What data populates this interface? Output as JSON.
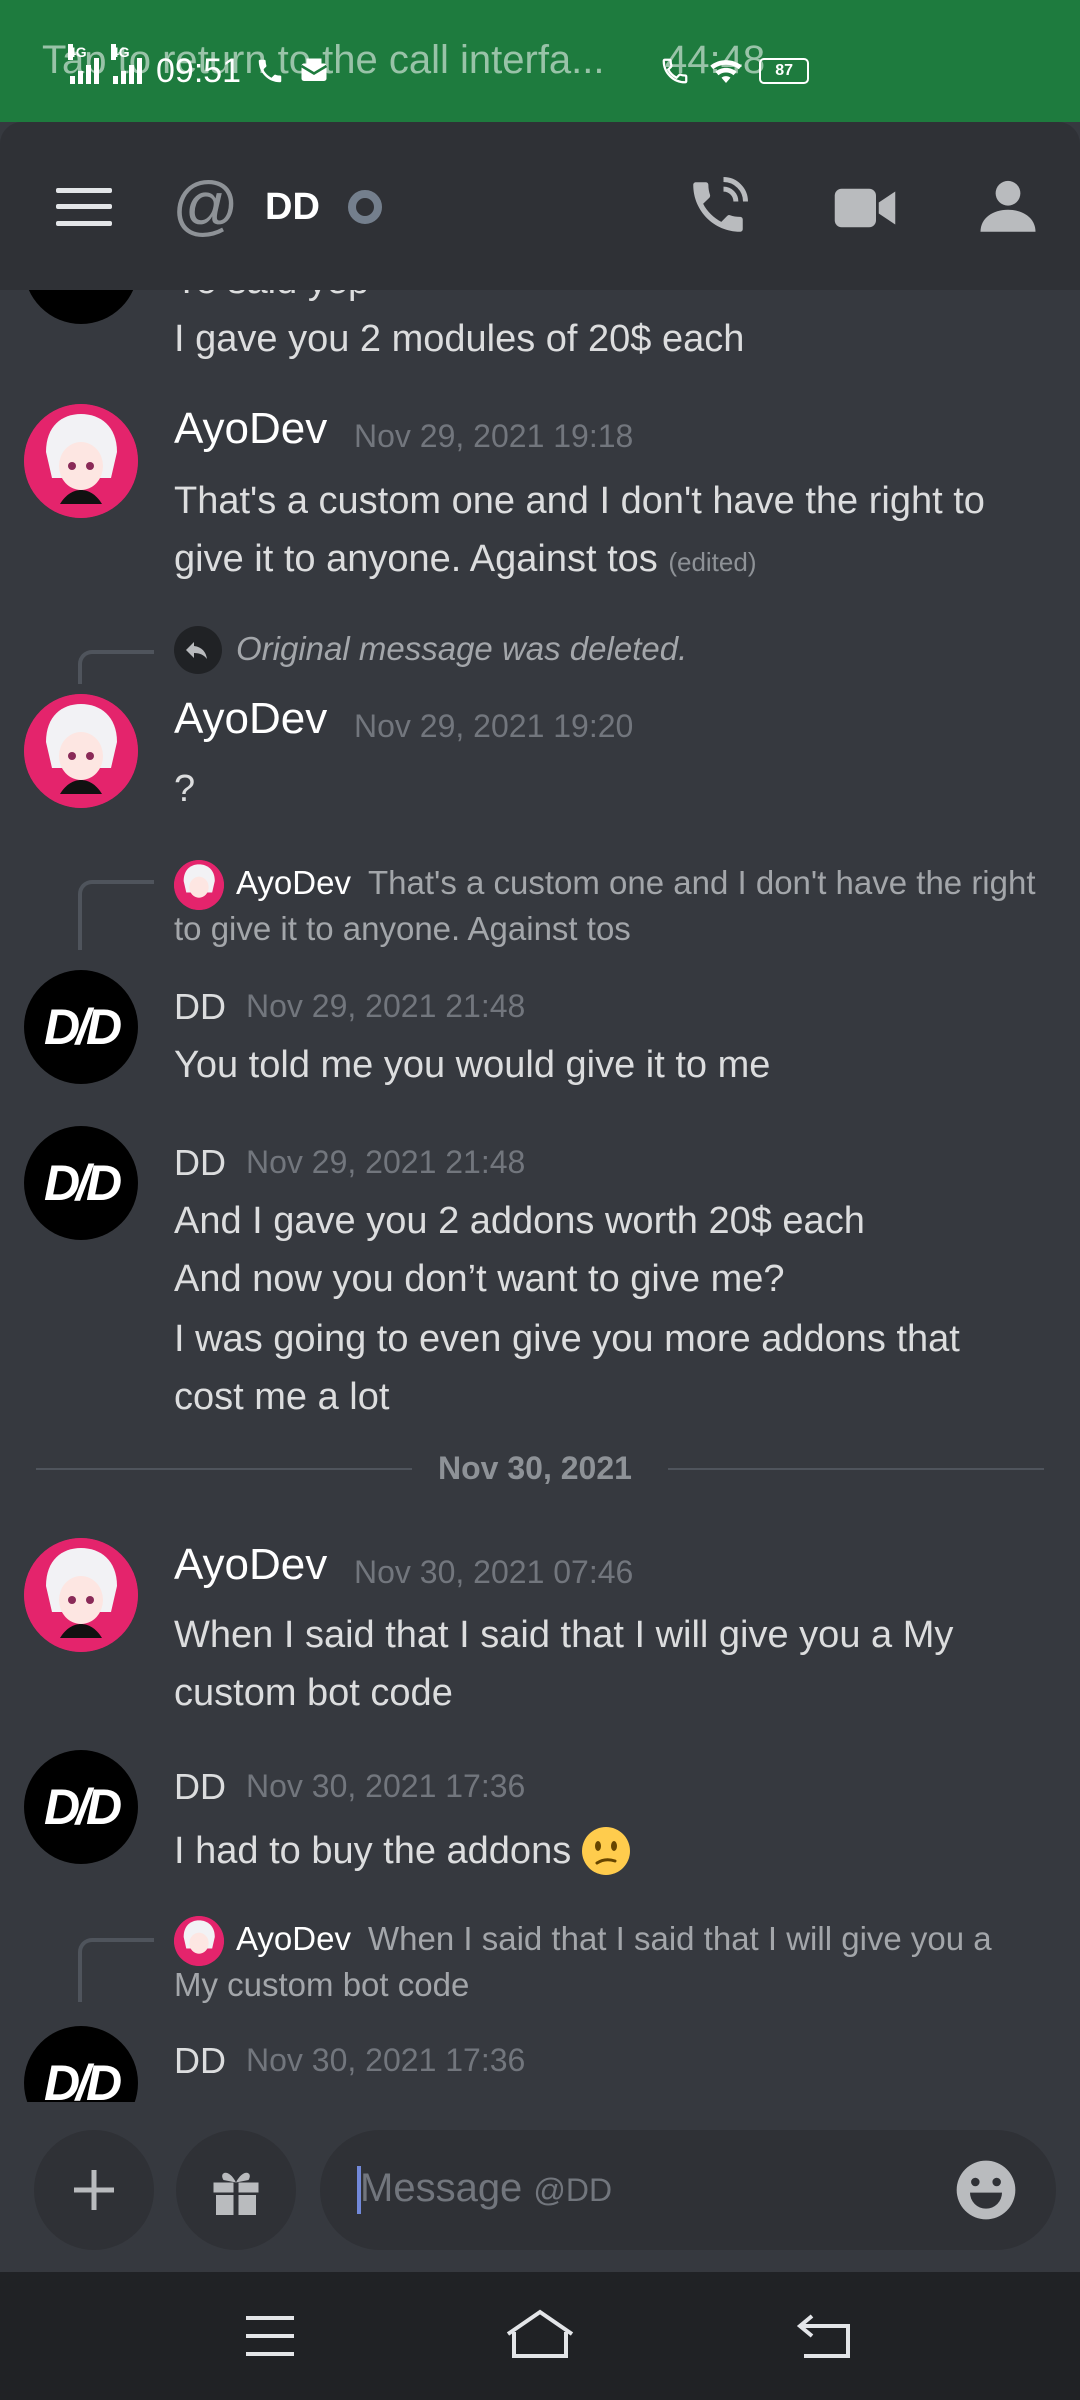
{
  "status_bar": {
    "banner": "Tap to return to the call interfa...",
    "timer": "44:48",
    "time": "09:51",
    "network_1": "4G",
    "network_2": "4G",
    "battery": "87"
  },
  "header": {
    "channel_name": "DD",
    "icons": [
      "menu-icon",
      "at-icon",
      "status-idle-icon",
      "call-icon",
      "video-icon",
      "members-icon"
    ]
  },
  "messages": [
    {
      "author": "",
      "text_top_partial": "Yo said yep",
      "text": "I gave you 2 modules of 20$ each"
    },
    {
      "author": "AyoDev",
      "timestamp": "Nov 29, 2021 19:18",
      "lines": [
        "That's a custom one and I don't have the right to",
        "give it to anyone. Against tos"
      ],
      "edited": "(edited)"
    },
    {
      "reply_preview": "Original message was deleted.",
      "author": "AyoDev",
      "timestamp": "Nov 29, 2021 19:20",
      "lines": [
        "?"
      ]
    },
    {
      "reply_author": "AyoDev",
      "reply_lines": [
        "That's a custom one and I don't have the right",
        "to give it to anyone. Against tos"
      ],
      "author": "DD",
      "timestamp": "Nov 29, 2021 21:48",
      "lines": [
        "You told me you would give it to me"
      ]
    },
    {
      "author": "DD",
      "timestamp": "Nov 29, 2021 21:48",
      "lines": [
        "And I gave you 2 addons worth 20$ each",
        "And now you don’t want to give me?",
        "I was going to even give you more addons that",
        "cost me a lot"
      ]
    },
    {
      "author": "AyoDev",
      "timestamp": "Nov 30, 2021 07:46",
      "lines": [
        "When I said that I said that I will give you a My",
        "custom bot code"
      ]
    },
    {
      "author": "DD",
      "timestamp": "Nov 30, 2021 17:36",
      "lines": [
        "I had to buy the addons"
      ],
      "emoji": "confused-face"
    },
    {
      "reply_author": "AyoDev",
      "reply_lines": [
        "When I said that I said that I will give you a",
        "My custom bot code"
      ],
      "author": "DD",
      "timestamp": "Nov 30, 2021 17:36"
    }
  ],
  "date_divider": "Nov 30, 2021",
  "composer": {
    "placeholder": "Message ",
    "placeholder_target": "@DD",
    "icons": [
      "plus-icon",
      "gift-icon",
      "emoji-icon"
    ]
  },
  "colors": {
    "background": "#36393f",
    "header": "#2f3136",
    "call_banner": "#1e7b3e",
    "text": "#dcddde",
    "timestamp": "#72767d",
    "accent": "#7289da"
  }
}
